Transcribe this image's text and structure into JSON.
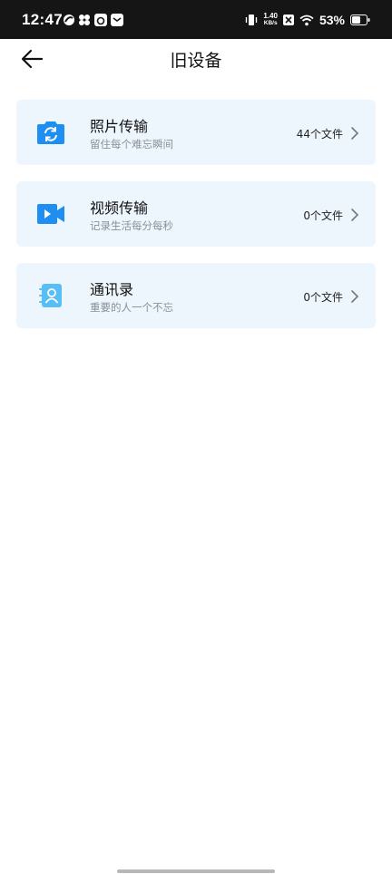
{
  "status_bar": {
    "time": "12:47",
    "net_speed_value": "1.40",
    "net_speed_unit": "KB/s",
    "battery_percent": "53%"
  },
  "header": {
    "title": "旧设备"
  },
  "items": [
    {
      "title": "照片传输",
      "subtitle": "留住每个难忘瞬间",
      "count": "44个文件",
      "icon": "camera-sync-icon"
    },
    {
      "title": "视频传输",
      "subtitle": "记录生活每分每秒",
      "count": "0个文件",
      "icon": "video-camera-icon"
    },
    {
      "title": "通讯录",
      "subtitle": "重要的人一个不忘",
      "count": "0个文件",
      "icon": "contacts-book-icon"
    }
  ],
  "colors": {
    "accent": "#1e8ff0",
    "card_bg": "#eef6fd",
    "status_bar_bg": "#151515"
  }
}
